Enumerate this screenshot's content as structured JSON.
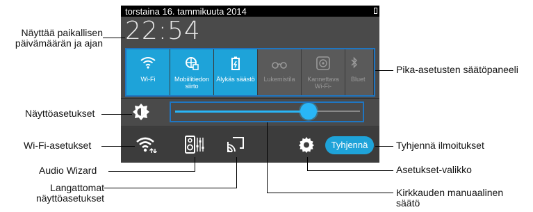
{
  "status_bar": {
    "date": "torstaina 16. tammikuuta 2014"
  },
  "clock": {
    "time": "22:54"
  },
  "quick_settings": {
    "tiles": [
      {
        "label": "Wi-Fi",
        "icon": "wifi-icon",
        "active": true
      },
      {
        "label": "Mobiilitiedon siirto",
        "icon": "mobile-data-icon",
        "active": true
      },
      {
        "label": "Älykäs säästö",
        "icon": "smart-saving-icon",
        "active": true
      },
      {
        "label": "Lukemistila",
        "icon": "reading-mode-icon",
        "active": false
      },
      {
        "label": "Kannettava Wi-Fi-",
        "icon": "portable-hotspot-icon",
        "active": false
      },
      {
        "label": "Bluet",
        "icon": "bluetooth-icon",
        "active": false
      }
    ]
  },
  "brightness": {
    "level": 0.72
  },
  "bottom_row": {
    "clear_label": "Tyhjennä"
  },
  "callouts": {
    "date_time": "Näyttää paikallisen päivämäärän ja ajan",
    "quick_panel": "Pika-asetusten säätöpaneeli",
    "display_settings": "Näyttöasetukset",
    "wifi_settings": "Wi-Fi-asetukset",
    "clear_notifications": "Tyhjennä ilmoitukset",
    "audio_wizard": "Audio Wizard",
    "settings_menu": "Asetukset-valikko",
    "wireless_display": "Langattomat näyttöasetukset",
    "manual_brightness": "Kirkkauden manuaalinen säätö"
  },
  "colors": {
    "accent": "#1ea3d9",
    "highlight_border": "#1f76c2",
    "panel": "#4a4a4a"
  }
}
